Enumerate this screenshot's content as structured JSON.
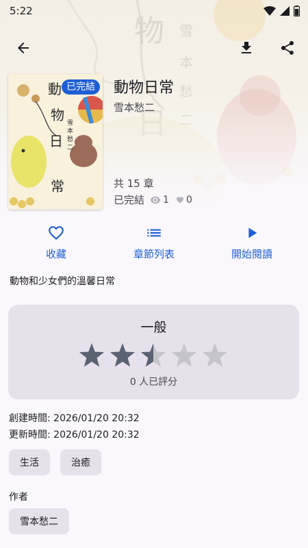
{
  "status_bar": {
    "time": "5:22"
  },
  "app_bar": {
    "back_icon": "arrow-back-icon",
    "download_icon": "download-icon",
    "share_icon": "share-icon"
  },
  "book": {
    "title": "動物日常",
    "author": "雪本愁二",
    "status_badge": "已完結",
    "chapter_count": "共 15 章",
    "status_text": "已完結",
    "views": "1",
    "likes": "0",
    "description": "動物和少女們的溫馨日常"
  },
  "cover_art": {
    "title_chars": [
      "動",
      "物",
      "日",
      "常"
    ],
    "author_vertical": "雪本愁二"
  },
  "actions": [
    {
      "label": "收藏",
      "icon": "heart-outline-icon"
    },
    {
      "label": "章節列表",
      "icon": "list-icon"
    },
    {
      "label": "開始閱讀",
      "icon": "play-icon"
    }
  ],
  "rating": {
    "label": "一般",
    "value": 2.5,
    "max": 5,
    "count_text": "0 人已評分"
  },
  "meta": {
    "created": "創建時間: 2026/01/20 20:32",
    "updated": "更新時間: 2026/01/20 20:32"
  },
  "tags": [
    "生活",
    "治癒"
  ],
  "authors_section": {
    "label": "作者",
    "names": [
      "雪本愁二"
    ]
  },
  "colors": {
    "accent": "#1e5fd6",
    "star_filled": "#5b6272",
    "star_empty": "#c7c5cc",
    "card_bg": "#e6e1ea"
  }
}
